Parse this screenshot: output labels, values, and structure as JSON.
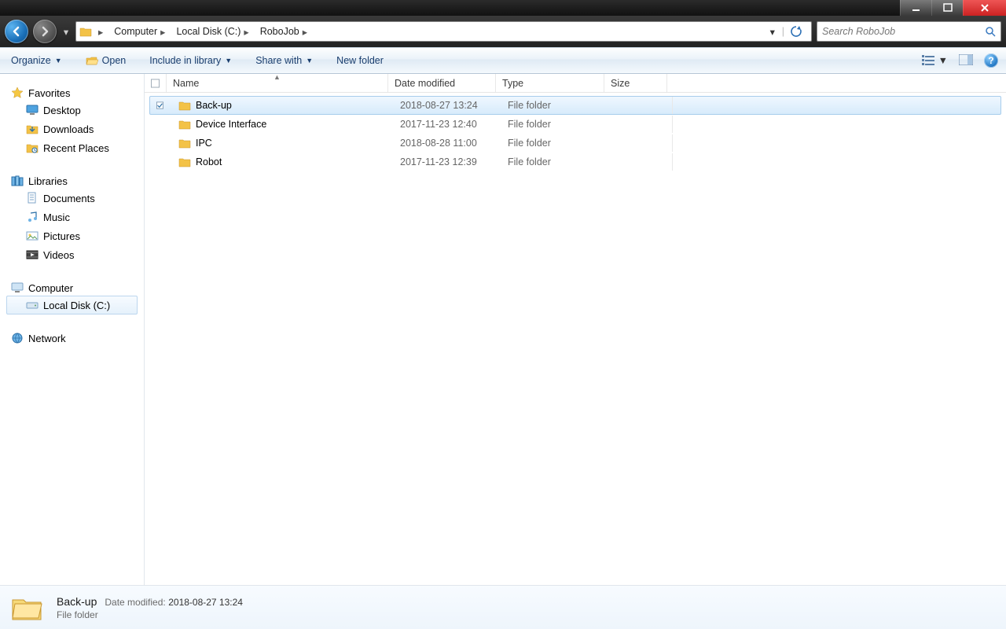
{
  "breadcrumb": {
    "items": [
      "Computer",
      "Local Disk (C:)",
      "RoboJob"
    ]
  },
  "search": {
    "placeholder": "Search RoboJob"
  },
  "toolbar": {
    "organize": "Organize",
    "open": "Open",
    "include": "Include in library",
    "share": "Share with",
    "newfolder": "New folder"
  },
  "columns": {
    "name": "Name",
    "date": "Date modified",
    "type": "Type",
    "size": "Size"
  },
  "nav": {
    "favorites": "Favorites",
    "desktop": "Desktop",
    "downloads": "Downloads",
    "recent": "Recent Places",
    "libraries": "Libraries",
    "documents": "Documents",
    "music": "Music",
    "pictures": "Pictures",
    "videos": "Videos",
    "computer": "Computer",
    "localdisk": "Local Disk (C:)",
    "network": "Network"
  },
  "files": [
    {
      "name": "Back-up",
      "date": "2018-08-27 13:24",
      "type": "File folder",
      "selected": true,
      "checked": true
    },
    {
      "name": "Device Interface",
      "date": "2017-11-23 12:40",
      "type": "File folder",
      "selected": false,
      "checked": false
    },
    {
      "name": "IPC",
      "date": "2018-08-28 11:00",
      "type": "File folder",
      "selected": false,
      "checked": false
    },
    {
      "name": "Robot",
      "date": "2017-11-23 12:39",
      "type": "File folder",
      "selected": false,
      "checked": false
    }
  ],
  "details": {
    "name": "Back-up",
    "date_label": "Date modified:",
    "date": "2018-08-27 13:24",
    "type": "File folder"
  }
}
